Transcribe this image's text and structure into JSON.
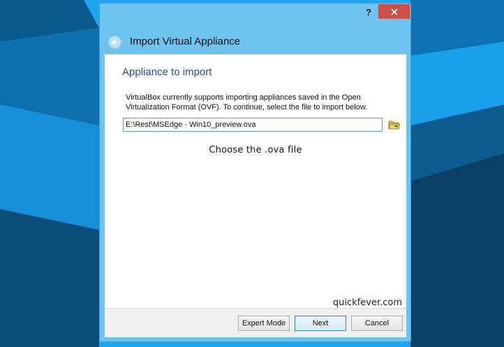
{
  "window": {
    "help_label": "?",
    "wizard_title": "Import Virtual Appliance"
  },
  "page": {
    "heading": "Appliance to import",
    "description": "VirtualBox currently supports importing appliances saved in the Open Virtualization Format (OVF). To continue, select the file to import below.",
    "file_path_value": "E:\\Rest\\MSEdge - Win10_preview.ova",
    "hint": "Choose the .ova file",
    "watermark": "quickfever.com"
  },
  "buttons": {
    "expert_mode": "Expert Mode",
    "next": "Next",
    "cancel": "Cancel"
  },
  "colors": {
    "titlebar": "#6ec4ef",
    "close_button": "#c7504a",
    "heading": "#1e4f96",
    "desktop_light": "#1fa6f0",
    "desktop_dark": "#0d4f7c"
  },
  "icons": [
    "help-icon",
    "close-icon",
    "back-arrow-icon",
    "open-folder-icon"
  ]
}
